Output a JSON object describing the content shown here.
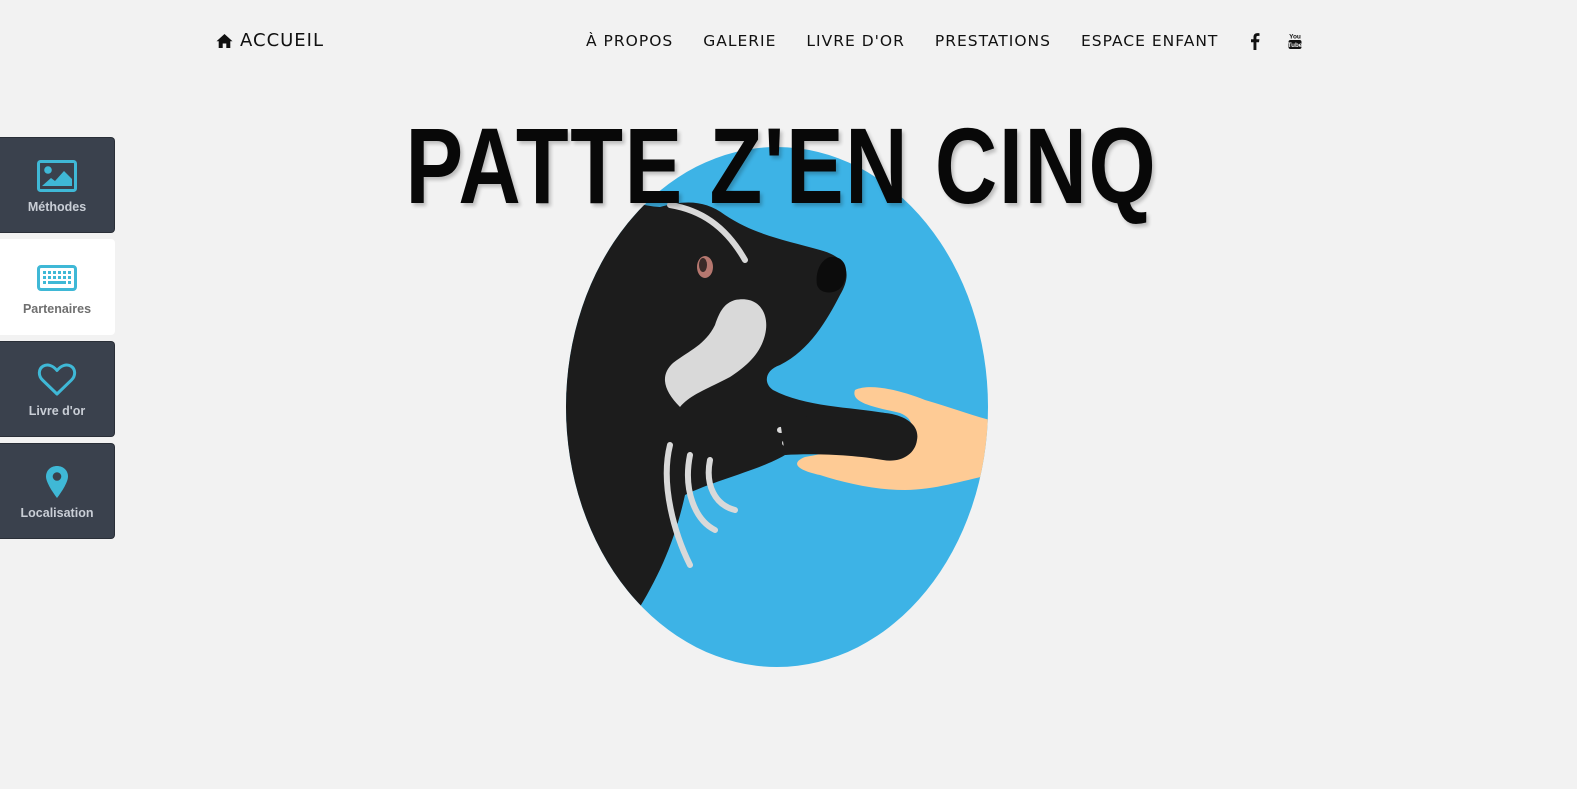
{
  "nav": {
    "home_label": "ACCUEIL",
    "links": [
      {
        "label": "À PROPOS"
      },
      {
        "label": "GALERIE"
      },
      {
        "label": "LIVRE D'OR"
      },
      {
        "label": "PRESTATIONS"
      },
      {
        "label": "ESPACE ENFANT"
      }
    ],
    "social": [
      {
        "icon": "facebook-icon"
      },
      {
        "icon": "youtube-icon",
        "text": "You Tube"
      }
    ]
  },
  "sidebar": {
    "items": [
      {
        "label": "Méthodes",
        "icon": "picture-icon",
        "active": false
      },
      {
        "label": "Partenaires",
        "icon": "keyboard-icon",
        "active": true
      },
      {
        "label": "Livre d'or",
        "icon": "heart-icon",
        "active": false
      },
      {
        "label": "Localisation",
        "icon": "map-pin-icon",
        "active": false
      }
    ]
  },
  "hero": {
    "title": "PATTE Z'EN CINQ"
  },
  "colors": {
    "accent": "#3fb8d6",
    "sidebar_bg": "#3a414d",
    "logo_blue": "#3db3e6",
    "skin": "#fecb95",
    "dog_black": "#1c1c1c",
    "dog_white": "#d9d9d9"
  }
}
